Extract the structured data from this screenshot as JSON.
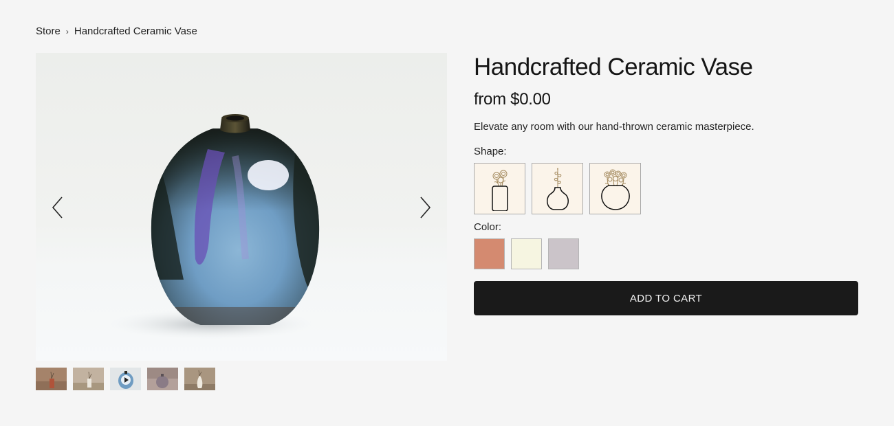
{
  "breadcrumb": {
    "root": "Store",
    "separator": "›",
    "current": "Handcrafted Ceramic Vase"
  },
  "gallery": {
    "prev_icon": "chevron-left-icon",
    "next_icon": "chevron-right-icon",
    "thumbnails": [
      {
        "name": "thumbnail-1",
        "tone": "#8a6a52"
      },
      {
        "name": "thumbnail-2",
        "tone": "#b9aa98"
      },
      {
        "name": "thumbnail-3",
        "tone": "#d9dee0",
        "video": true
      },
      {
        "name": "thumbnail-4",
        "tone": "#9c8a84"
      },
      {
        "name": "thumbnail-5",
        "tone": "#a4927c"
      }
    ]
  },
  "product": {
    "title": "Handcrafted Ceramic Vase",
    "price": "from $0.00",
    "description": "Elevate any room with our hand-thrown ceramic masterpiece."
  },
  "options": {
    "shape_label": "Shape:",
    "shapes": [
      {
        "name": "tall-cylinder-vase-icon"
      },
      {
        "name": "round-bud-vase-icon"
      },
      {
        "name": "round-bowl-vase-icon"
      }
    ],
    "color_label": "Color:",
    "colors": [
      {
        "name": "terracotta",
        "hex": "#d48a70"
      },
      {
        "name": "cream",
        "hex": "#f6f5e1"
      },
      {
        "name": "lavender-grey",
        "hex": "#cbc4c9"
      }
    ]
  },
  "cart": {
    "add_label": "ADD TO CART"
  },
  "colors": {
    "background": "#f5f5f5",
    "button": "#1a1a1a",
    "button_text": "#f2f2f2",
    "option_tile": "#fbf4ea"
  }
}
